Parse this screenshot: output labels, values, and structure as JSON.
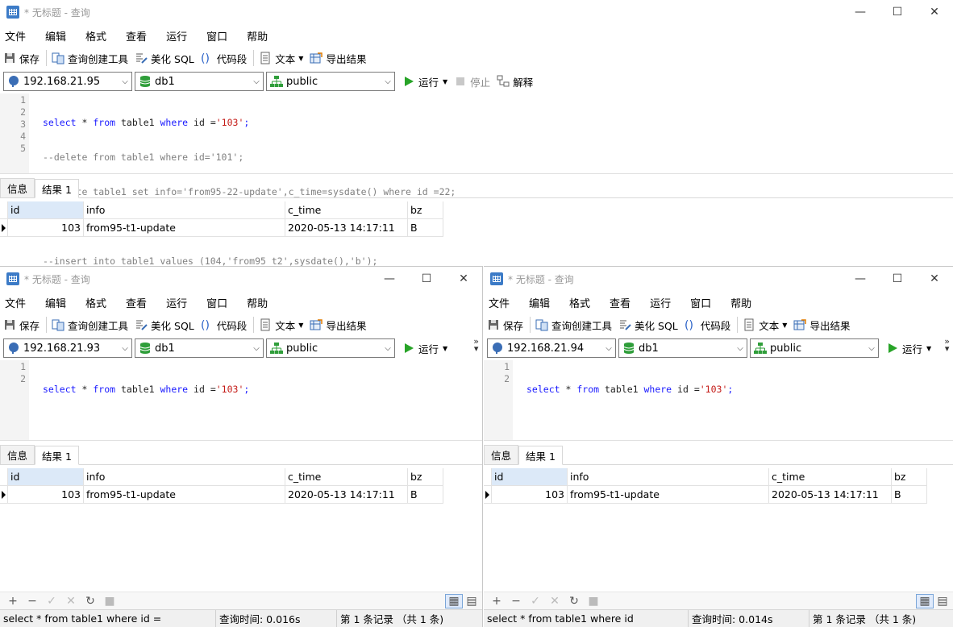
{
  "windows": [
    {
      "title": "* 无标题 - 查询",
      "menu": [
        "文件",
        "编辑",
        "格式",
        "查看",
        "运行",
        "窗口",
        "帮助"
      ],
      "toolbar": {
        "save": "保存",
        "query_builder": "查询创建工具",
        "beautify": "美化 SQL",
        "snippet": "代码段",
        "text": "文本",
        "export": "导出结果"
      },
      "connection": "192.168.21.95",
      "database": "db1",
      "schema": "public",
      "run": "运行",
      "stop": "停止",
      "explain": "解释",
      "editor_lines": [
        "select * from table1 where id ='103';",
        "--delete from table1 where id='101';",
        "--update table1 set info='from95-22-update',c_time=sysdate() where id =22;",
        "",
        "--insert into table1 values (104,'from95_t2',sysdate(),'b');"
      ],
      "tabs": [
        "信息",
        "结果 1"
      ],
      "columns": [
        "id",
        "info",
        "c_time",
        "bz"
      ],
      "rows": [
        [
          "103",
          "from95-t1-update",
          "2020-05-13 14:17:11",
          "B"
        ]
      ]
    },
    {
      "title": "* 无标题 - 查询",
      "menu": [
        "文件",
        "编辑",
        "格式",
        "查看",
        "运行",
        "窗口",
        "帮助"
      ],
      "toolbar": {
        "save": "保存",
        "query_builder": "查询创建工具",
        "beautify": "美化 SQL",
        "snippet": "代码段",
        "text": "文本",
        "export": "导出结果"
      },
      "connection": "192.168.21.93",
      "database": "db1",
      "schema": "public",
      "run": "运行",
      "editor_lines": [
        "select * from table1 where id ='103';",
        ""
      ],
      "tabs": [
        "信息",
        "结果 1"
      ],
      "columns": [
        "id",
        "info",
        "c_time",
        "bz"
      ],
      "rows": [
        [
          "103",
          "from95-t1-update",
          "2020-05-13 14:17:11",
          "B"
        ]
      ],
      "status": {
        "sql": "select * from table1 where id =",
        "time": "查询时间: 0.016s",
        "records": "第 1 条记录 （共 1 条)"
      }
    },
    {
      "title": "* 无标题 - 查询",
      "menu": [
        "文件",
        "编辑",
        "格式",
        "查看",
        "运行",
        "窗口",
        "帮助"
      ],
      "toolbar": {
        "save": "保存",
        "query_builder": "查询创建工具",
        "beautify": "美化 SQL",
        "snippet": "代码段",
        "text": "文本",
        "export": "导出结果"
      },
      "connection": "192.168.21.94",
      "database": "db1",
      "schema": "public",
      "run": "运行",
      "editor_lines": [
        "select * from table1 where id ='103';",
        ""
      ],
      "tabs": [
        "信息",
        "结果 1"
      ],
      "columns": [
        "id",
        "info",
        "c_time",
        "bz"
      ],
      "rows": [
        [
          "103",
          "from95-t1-update",
          "2020-05-13 14:17:11",
          "B"
        ]
      ],
      "status": {
        "sql": "select * from table1 where id",
        "time": "查询时间: 0.014s",
        "records": "第 1 条记录 （共 1 条)"
      }
    }
  ]
}
